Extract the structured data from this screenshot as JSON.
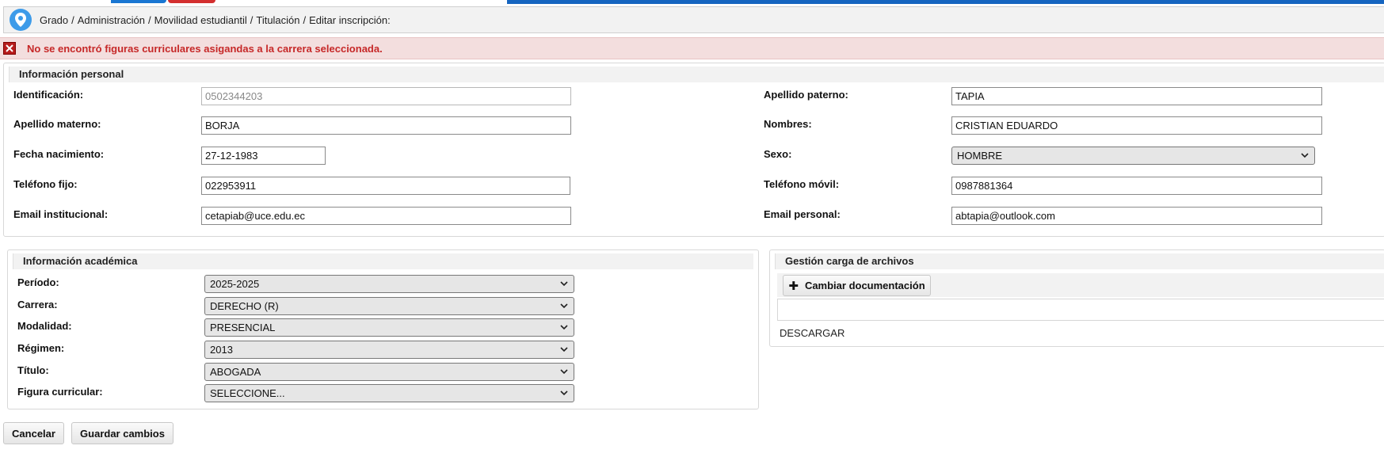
{
  "breadcrumb": {
    "items": [
      "Grado",
      "Administración",
      "Movilidad estudiantil",
      "Titulación",
      "Editar inscripción:"
    ],
    "separator": "/"
  },
  "alert": {
    "message": "No se encontró figuras curriculares asigandas a la carrera seleccionada."
  },
  "personal": {
    "title": "Información personal",
    "identificacion_label": "Identificación:",
    "identificacion_value": "0502344203",
    "apellido_paterno_label": "Apellido paterno:",
    "apellido_paterno_value": "TAPIA",
    "apellido_materno_label": "Apellido materno:",
    "apellido_materno_value": "BORJA",
    "nombres_label": "Nombres:",
    "nombres_value": "CRISTIAN EDUARDO",
    "fecha_label": "Fecha nacimiento:",
    "fecha_value": "27-12-1983",
    "sexo_label": "Sexo:",
    "sexo_value": "HOMBRE",
    "telefono_fijo_label": "Teléfono fijo:",
    "telefono_fijo_value": "022953911",
    "telefono_movil_label": "Teléfono móvil:",
    "telefono_movil_value": "0987881364",
    "email_inst_label": "Email institucional:",
    "email_inst_value": "cetapiab@uce.edu.ec",
    "email_personal_label": "Email personal:",
    "email_personal_value": "abtapia@outlook.com"
  },
  "academic": {
    "title": "Información académica",
    "periodo_label": "Período:",
    "periodo_value": "2025-2025",
    "carrera_label": "Carrera:",
    "carrera_value": "DERECHO (R)",
    "modalidad_label": "Modalidad:",
    "modalidad_value": "PRESENCIAL",
    "regimen_label": "Régimen:",
    "regimen_value": "2013",
    "titulo_label": "Título:",
    "titulo_value": "ABOGADA",
    "figura_label": "Figura curricular:",
    "figura_value": "SELECCIONE..."
  },
  "files": {
    "title": "Gestión carga de archivos",
    "change_button": "Cambiar documentación",
    "download_label": "DESCARGAR"
  },
  "actions": {
    "cancel": "Cancelar",
    "save": "Guardar cambios"
  }
}
